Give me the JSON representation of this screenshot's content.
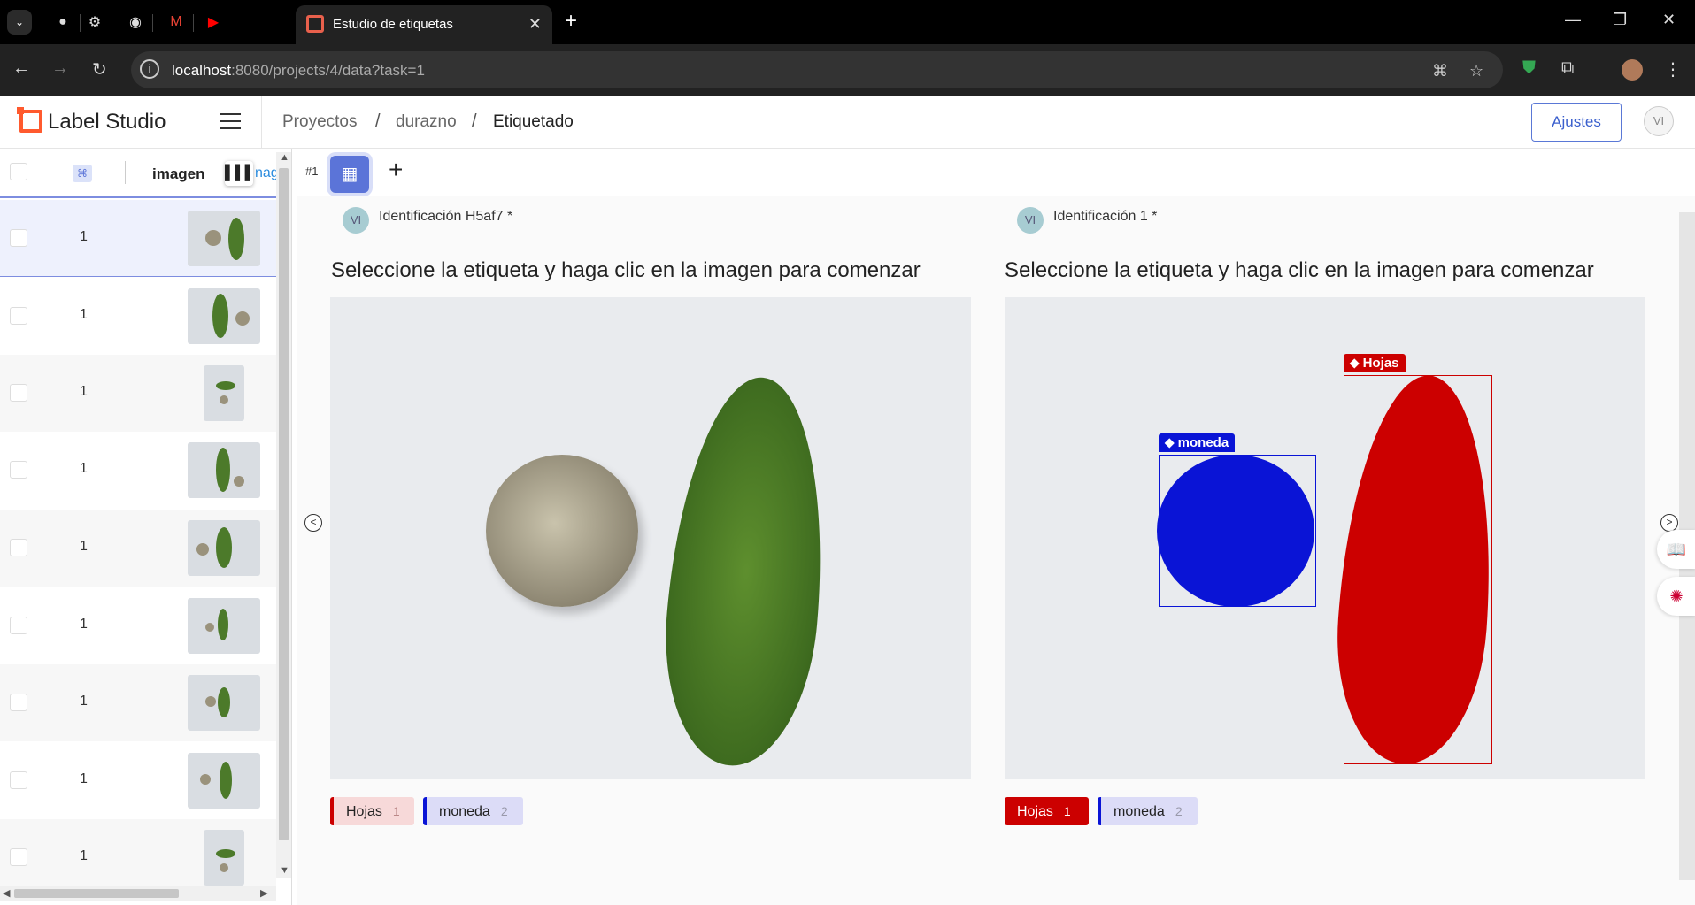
{
  "browser": {
    "tab_title": "Estudio de etiquetas",
    "url_host": "localhost",
    "url_rest": ":8080/projects/4/data?task=1"
  },
  "header": {
    "logo": "Label Studio",
    "breadcrumbs": [
      "Proyectos",
      "durazno",
      "Etiquetado"
    ],
    "settings_label": "Ajustes",
    "user_initials": "VI"
  },
  "table": {
    "column_label": "imagen",
    "column_cut": "nag",
    "rows": [
      {
        "value": "1"
      },
      {
        "value": "1"
      },
      {
        "value": "1"
      },
      {
        "value": "1"
      },
      {
        "value": "1"
      },
      {
        "value": "1"
      },
      {
        "value": "1"
      },
      {
        "value": "1"
      },
      {
        "value": "1"
      }
    ]
  },
  "toolbar": {
    "task_id": "#1",
    "add_symbol": "+"
  },
  "annotations": [
    {
      "avatar": "VI",
      "title": "Identificación H5af7 *",
      "instruction": "Seleccione la etiqueta y haga clic en la imagen para comenzar",
      "labels": [
        {
          "name": "Hojas",
          "hotkey": "1",
          "color": "#cc0000",
          "selected": false
        },
        {
          "name": "moneda",
          "hotkey": "2",
          "color": "#0a14d6",
          "selected": false
        }
      ]
    },
    {
      "avatar": "VI",
      "title": "Identificación 1 *",
      "instruction": "Seleccione la etiqueta y haga clic en la imagen para comenzar",
      "regions": [
        {
          "label": "moneda",
          "color": "#0a14d6"
        },
        {
          "label": "Hojas",
          "color": "#cc0000"
        }
      ],
      "labels": [
        {
          "name": "Hojas",
          "hotkey": "1",
          "color": "#cc0000",
          "selected": true
        },
        {
          "name": "moneda",
          "hotkey": "2",
          "color": "#0a14d6",
          "selected": false
        }
      ]
    }
  ],
  "colors": {
    "accent": "#5b74d8",
    "hojas": "#cc0000",
    "moneda": "#0a14d6"
  }
}
